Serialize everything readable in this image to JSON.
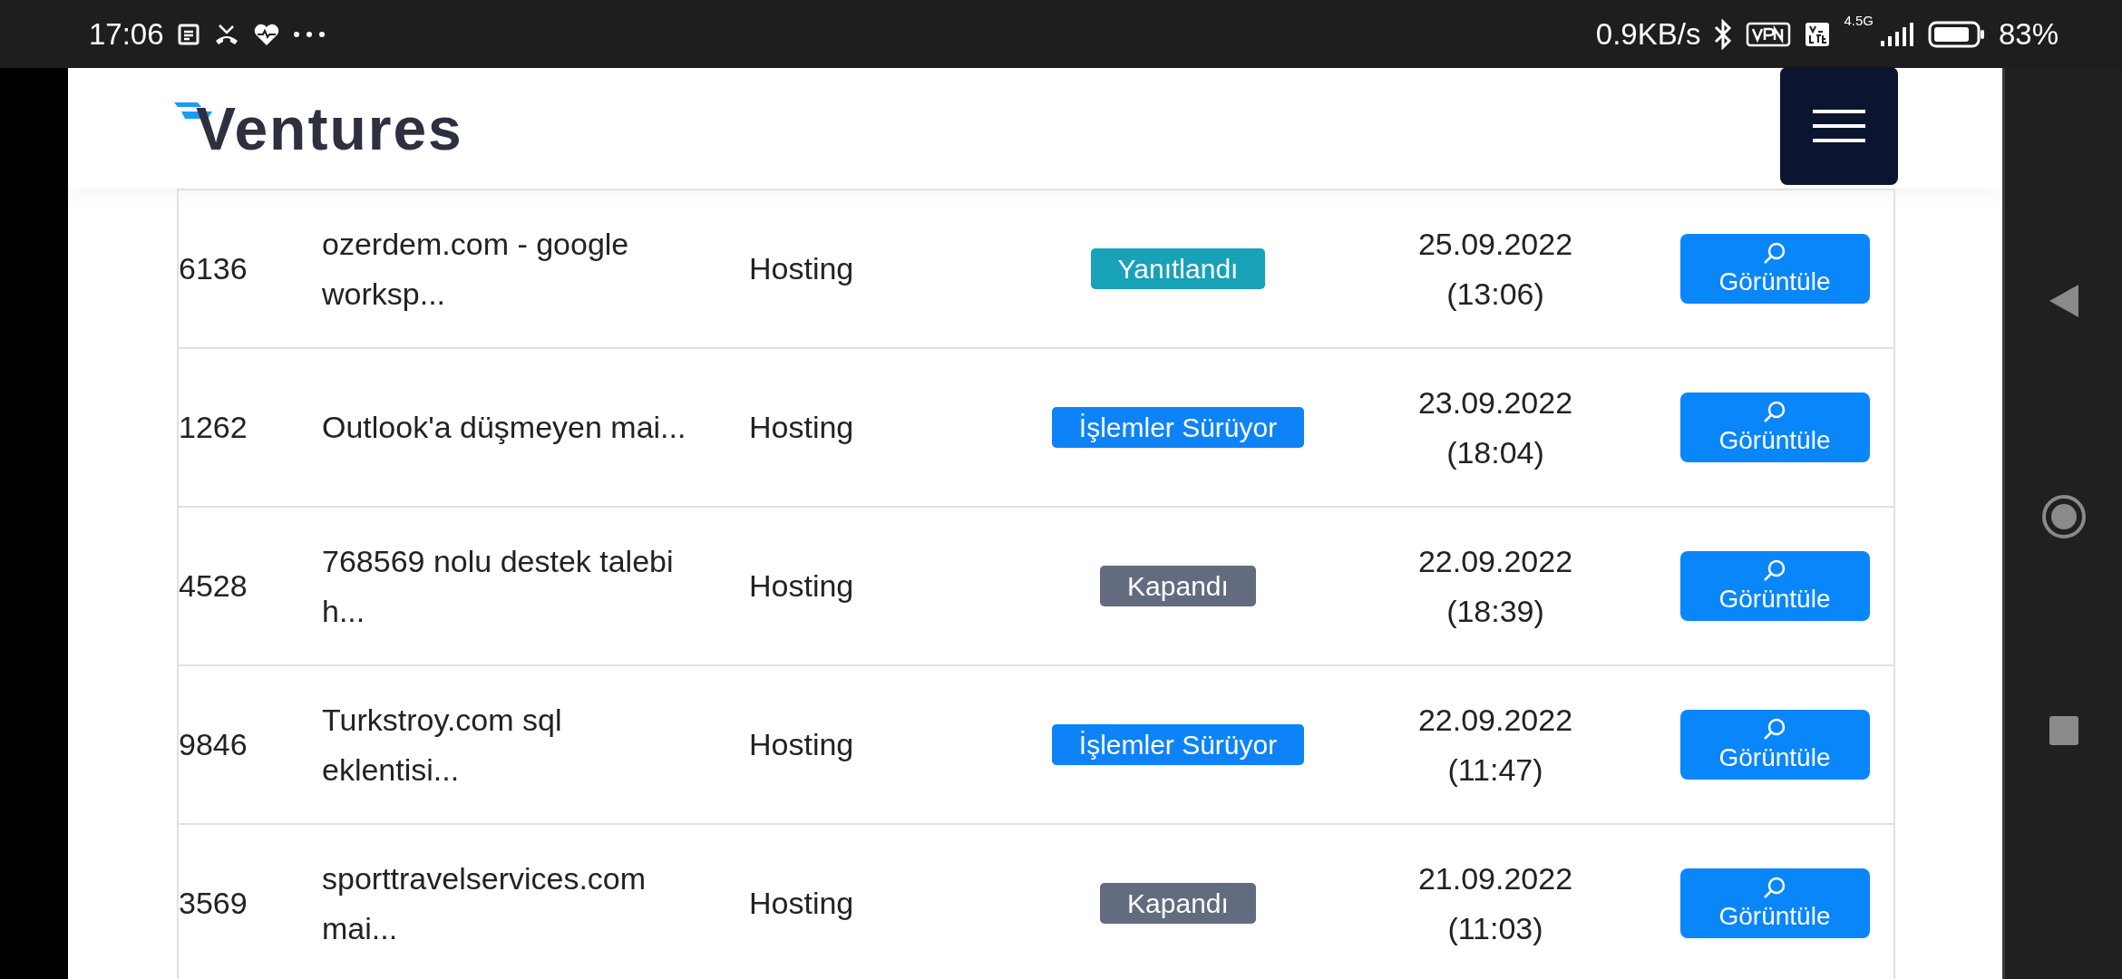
{
  "status_bar": {
    "time": "17:06",
    "network_speed": "0.9KB/s",
    "network_type": "4.5G",
    "battery": "83%"
  },
  "header": {
    "logo": "Ventures"
  },
  "table": {
    "rows": [
      {
        "id": "6136",
        "subject": "ozerdem.com - google worksp...",
        "department": "Hosting",
        "status": {
          "label": "Yanıtlandı",
          "color": "#17a2b8"
        },
        "date": "25.09.2022",
        "time": "(13:06)",
        "action": "Görüntüle"
      },
      {
        "id": "1262",
        "subject": "Outlook'a düşmeyen mai...",
        "department": "Hosting",
        "status": {
          "label": "İşlemler Sürüyor",
          "color": "#0d83f7"
        },
        "date": "23.09.2022",
        "time": "(18:04)",
        "action": "Görüntüle"
      },
      {
        "id": "4528",
        "subject": "768569 nolu destek talebi h...",
        "department": "Hosting",
        "status": {
          "label": "Kapandı",
          "color": "#636b7f"
        },
        "date": "22.09.2022",
        "time": "(18:39)",
        "action": "Görüntüle"
      },
      {
        "id": "9846",
        "subject": "Turkstroy.com sql eklentisi...",
        "department": "Hosting",
        "status": {
          "label": "İşlemler Sürüyor",
          "color": "#0d83f7"
        },
        "date": "22.09.2022",
        "time": "(11:47)",
        "action": "Görüntüle"
      },
      {
        "id": "3569",
        "subject": "sporttravelservices.com mai...",
        "department": "Hosting",
        "status": {
          "label": "Kapandı",
          "color": "#636b7f"
        },
        "date": "21.09.2022",
        "time": "(11:03)",
        "action": "Görüntüle"
      }
    ]
  }
}
